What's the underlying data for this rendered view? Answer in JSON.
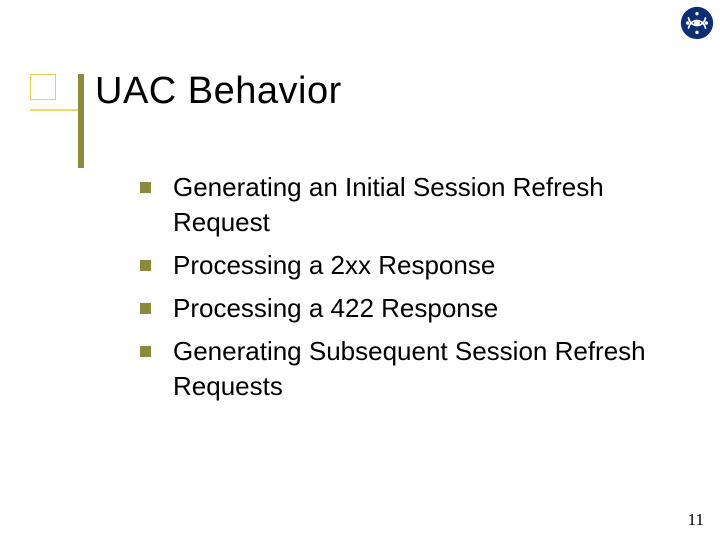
{
  "title": "UAC Behavior",
  "bullets": [
    "Generating an Initial Session Refresh Request",
    "Processing a 2xx Response",
    "Processing a 422 Response",
    "Generating Subsequent Session Refresh Requests"
  ],
  "page_number": "11"
}
